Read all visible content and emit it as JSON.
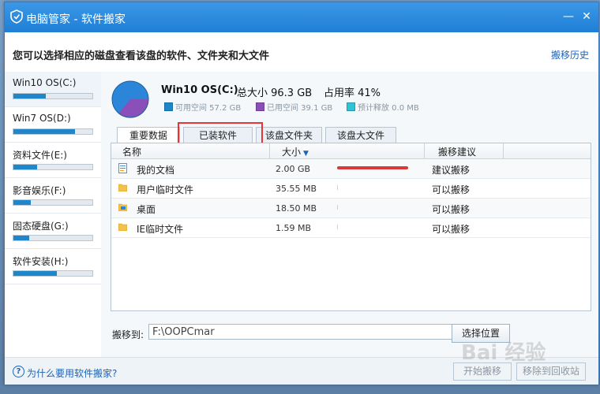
{
  "window": {
    "title": "电脑管家 - 软件搬家",
    "minimize": "—",
    "close": "✕"
  },
  "header": {
    "title": "您可以选择相应的磁盘查看该盘的软件、文件夹和大文件",
    "history_link": "搬移历史"
  },
  "sidebar": {
    "drives": [
      {
        "label": "Win10 OS(C:)",
        "usage": 0.41,
        "active": true
      },
      {
        "label": "Win7 OS(D:)",
        "usage": 0.78,
        "active": false
      },
      {
        "label": "资料文件(E:)",
        "usage": 0.3,
        "active": false
      },
      {
        "label": "影音娱乐(F:)",
        "usage": 0.22,
        "active": false
      },
      {
        "label": "固态硬盘(G:)",
        "usage": 0.2,
        "active": false
      },
      {
        "label": "软件安装(H:)",
        "usage": 0.55,
        "active": false
      }
    ]
  },
  "disk": {
    "name": "Win10 OS(C:)",
    "total": "总大小 96.3 GB",
    "rate": "占用率 41%",
    "legend": [
      {
        "label": "可用空间 57.2 GB",
        "color": "#1f86c9"
      },
      {
        "label": "已用空间 39.1 GB",
        "color": "#8a4fb8"
      },
      {
        "label": "预计释放 0.0 MB",
        "color": "#2ec4d6"
      }
    ],
    "used_fraction": 0.41
  },
  "tabs": [
    {
      "label": "重要数据",
      "active": true
    },
    {
      "label": "已装软件",
      "active": false
    },
    {
      "label": "该盘文件夹",
      "active": false
    },
    {
      "label": "该盘大文件",
      "active": false
    }
  ],
  "table": {
    "headers": {
      "name": "名称",
      "size": "大小",
      "suggestion": "搬移建议"
    },
    "sort_icon": "sort-down-icon",
    "rows": [
      {
        "name": "我的文档",
        "size": "2.00 GB",
        "ratio": 0.55,
        "suggestion": "建议搬移",
        "icon": "document-icon"
      },
      {
        "name": "用户临时文件",
        "size": "35.55 MB",
        "ratio": 0.01,
        "suggestion": "可以搬移",
        "icon": "folder-icon"
      },
      {
        "name": "桌面",
        "size": "18.50 MB",
        "ratio": 0.005,
        "suggestion": "可以搬移",
        "icon": "desktop-folder-icon"
      },
      {
        "name": "IE临时文件",
        "size": "1.59 MB",
        "ratio": 0.001,
        "suggestion": "可以搬移",
        "icon": "folder-icon"
      }
    ]
  },
  "move": {
    "label": "搬移到:",
    "path": "F:\\OOPCmar",
    "choose_button": "选择位置"
  },
  "footer": {
    "help_icon": "?",
    "help_link": "为什么要用软件搬家?",
    "start_button": "开始搬移",
    "recycle_button": "移除到回收站"
  },
  "watermark": "Bai 经验"
}
